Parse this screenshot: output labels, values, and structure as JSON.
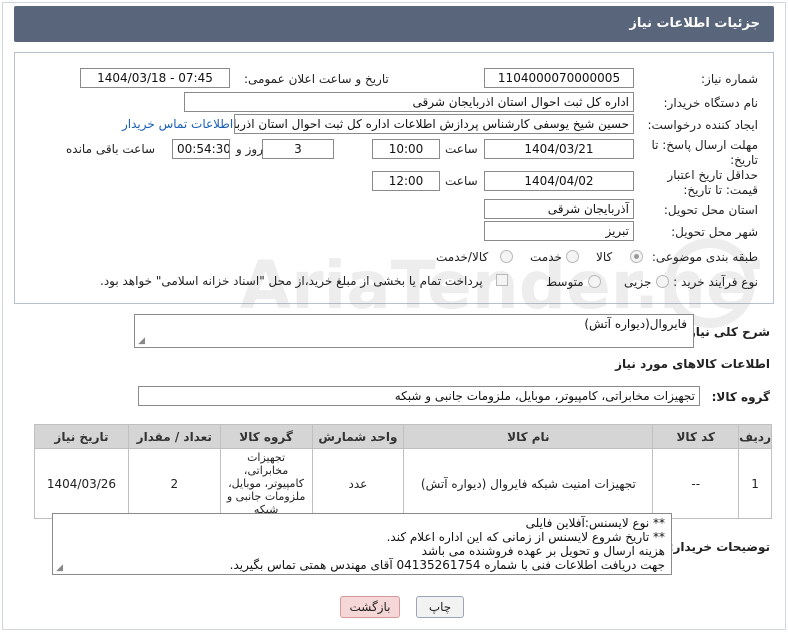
{
  "header": {
    "title": "جزئیات اطلاعات نیاز"
  },
  "form": {
    "need_number_label": "شماره نیاز:",
    "need_number": "1104000070000005",
    "announce_label": "تاریخ و ساعت اعلان عمومی:",
    "announce_value": "1404/03/18 - 07:45",
    "buyer_org_label": "نام دستگاه خریدار:",
    "buyer_org": "اداره کل ثبت احوال استان اذربایجان شرقی",
    "creator_label": "ایجاد کننده درخواست:",
    "creator": "حسین شیخ یوسفی کارشناس پردازش اطلاعات اداره کل ثبت احوال استان اذربا",
    "contact_link": "اطلاعات تماس خریدار",
    "reply_deadline_label": "مهلت ارسال پاسخ: تا تاریخ:",
    "reply_date": "1404/03/21",
    "time_label": "ساعت",
    "reply_time": "10:00",
    "days_value": "3",
    "days_label": "روز و",
    "remaining_time": "00:54:30",
    "remaining_label": "ساعت باقی مانده",
    "price_validity_label": "حداقل تاریخ اعتبار قیمت: تا تاریخ:",
    "price_date": "1404/04/02",
    "price_time": "12:00",
    "delivery_province_label": "استان محل تحویل:",
    "delivery_province": "آذربایجان شرقی",
    "delivery_city_label": "شهر محل تحویل:",
    "delivery_city": "تبریز",
    "category_label": "طبقه بندی موضوعی:",
    "category_options": [
      "کالا",
      "خدمت",
      "کالا/خدمت"
    ],
    "category_selected": "کالا",
    "process_label": "نوع فرآیند خرید :",
    "process_options": [
      "جزیی",
      "متوسط"
    ],
    "payment_note": "پرداخت تمام یا بخشی از مبلغ خرید،از محل \"اسناد خزانه اسلامی\" خواهد بود."
  },
  "description": {
    "label": "شرح کلی نیاز:",
    "value": "فایروال(دیواره آتش)"
  },
  "goods": {
    "section_title": "اطلاعات کالاهای مورد نیاز",
    "group_label": "گروه کالا:",
    "group_value": "تجهیزات مخابراتی، کامپیوتر، موبایل، ملزومات جانبی و شبکه",
    "columns": [
      "ردیف",
      "کد کالا",
      "نام کالا",
      "واحد شمارش",
      "گروه کالا",
      "تعداد / مقدار",
      "تاریخ نیاز"
    ],
    "rows": [
      {
        "row": "1",
        "code": "--",
        "name": "تجهیزات امنیت شبکه فایروال (دیواره آتش)",
        "unit": "عدد",
        "group": "تجهیزات مخابراتی، کامپیوتر، موبایل، ملزومات جانبی و شبکه",
        "qty": "2",
        "date": "1404/03/26"
      }
    ]
  },
  "notes": {
    "label": "توضیحات خریدار:",
    "lines": [
      "** نوع لایسنس:آفلاین فایلی",
      "** تاریخ شروع لایسنس از زمانی که این اداره اعلام کند.",
      "هزینه ارسال و تحویل بر عهده فروشنده می باشد",
      "جهت دریافت اطلاعات فنی با شماره 04135261754 آقای مهندس همتی تماس بگیرید."
    ]
  },
  "buttons": {
    "print": "چاپ",
    "back": "بازگشت"
  },
  "watermark": {
    "text": "AriaTender.neT"
  },
  "colors": {
    "titlebar": "#58657a",
    "link": "#1a5fb4",
    "back_button": "#f6d7d7"
  }
}
